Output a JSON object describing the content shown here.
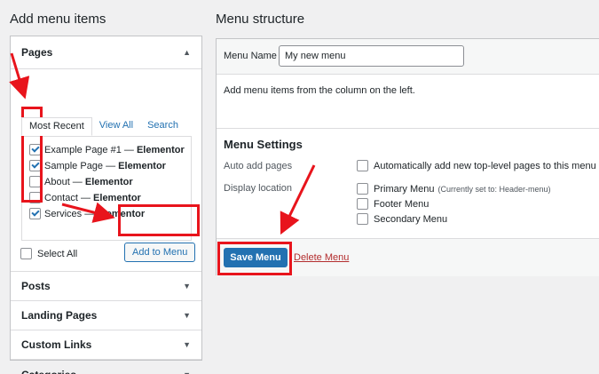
{
  "left": {
    "heading": "Add menu items",
    "pages": {
      "title": "Pages",
      "tabs": [
        "Most Recent",
        "View All",
        "Search"
      ],
      "items": [
        {
          "label": "Example Page #1",
          "suffix": "Elementor",
          "checked": true
        },
        {
          "label": "Sample Page",
          "suffix": "Elementor",
          "checked": true
        },
        {
          "label": "About",
          "suffix": "Elementor",
          "checked": false
        },
        {
          "label": "Contact",
          "suffix": "Elementor",
          "checked": false
        },
        {
          "label": "Services",
          "suffix": "Elementor",
          "checked": true
        }
      ],
      "separator": " — ",
      "select_all": "Select All",
      "add_button": "Add to Menu"
    },
    "sections": [
      "Posts",
      "Landing Pages",
      "Custom Links",
      "Categories"
    ],
    "arrow_up": "▲",
    "arrow_down": "▼"
  },
  "right": {
    "heading": "Menu structure",
    "menu_name_label": "Menu Name",
    "menu_name_value": "My new menu",
    "hint": "Add menu items from the column on the left.",
    "settings_title": "Menu Settings",
    "auto_add_label": "Auto add pages",
    "auto_add_option": "Automatically add new top-level pages to this menu",
    "display_location_label": "Display location",
    "locations": [
      {
        "label": "Primary Menu",
        "note": "(Currently set to: Header-menu)"
      },
      {
        "label": "Footer Menu",
        "note": ""
      },
      {
        "label": "Secondary Menu",
        "note": ""
      }
    ],
    "save_button": "Save Menu",
    "delete_link": "Delete Menu"
  },
  "colors": {
    "accent": "#2271b1",
    "annotation": "#e8141c",
    "danger": "#b32d2e"
  }
}
